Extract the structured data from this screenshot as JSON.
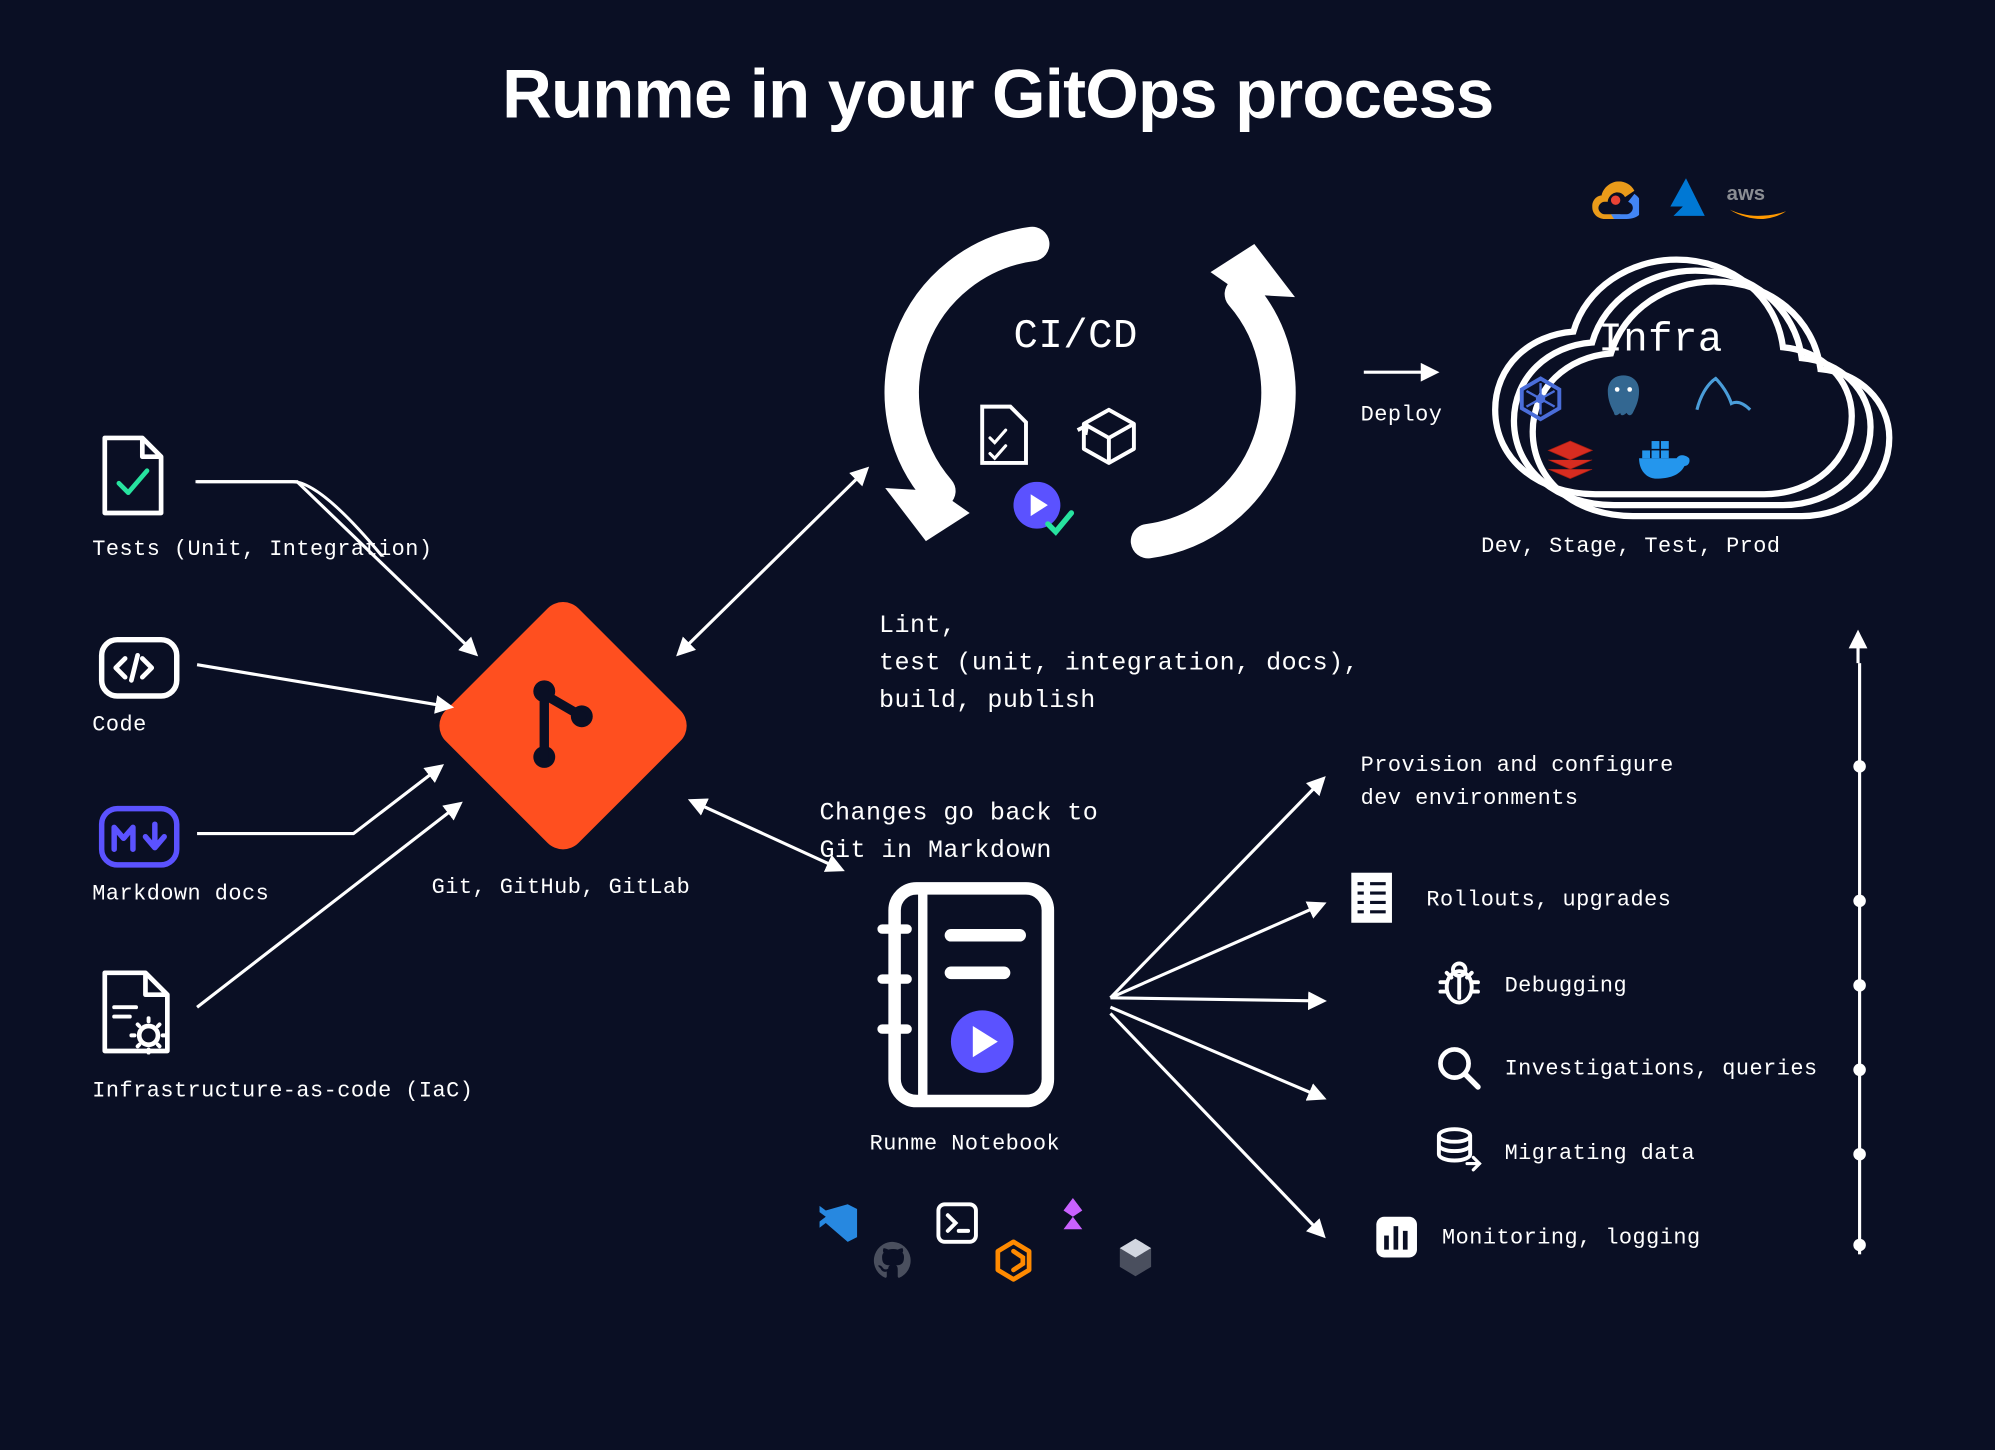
{
  "title": "Runme in your GitOps process",
  "inputs": {
    "tests": "Tests (Unit, Integration)",
    "code": "Code",
    "markdown": "Markdown docs",
    "iac": "Infrastructure-as-code (IaC)"
  },
  "git": {
    "label": "Git, GitHub, GitLab"
  },
  "cicd": {
    "title": "CI/CD",
    "description_1": "Lint,",
    "description_2": "test (unit, integration, docs),",
    "description_3": "build, publish"
  },
  "deploy": {
    "label": "Deploy"
  },
  "infra": {
    "title": "Infra",
    "envs": "Dev, Stage, Test, Prod",
    "providers": [
      "gcp",
      "azure",
      "aws"
    ]
  },
  "notebook": {
    "back_label_1": "Changes go back to",
    "back_label_2": "Git in Markdown",
    "label": "Runme Notebook",
    "integrations": [
      "vscode",
      "github",
      "terminal",
      "gitpod",
      "fleet",
      "devbox"
    ]
  },
  "tasks": {
    "provision_1": "Provision and configure",
    "provision_2": "dev environments",
    "rollouts": "Rollouts, upgrades",
    "debugging": "Debugging",
    "investigations": "Investigations, queries",
    "migrating": "Migrating data",
    "monitoring": "Monitoring, logging"
  }
}
